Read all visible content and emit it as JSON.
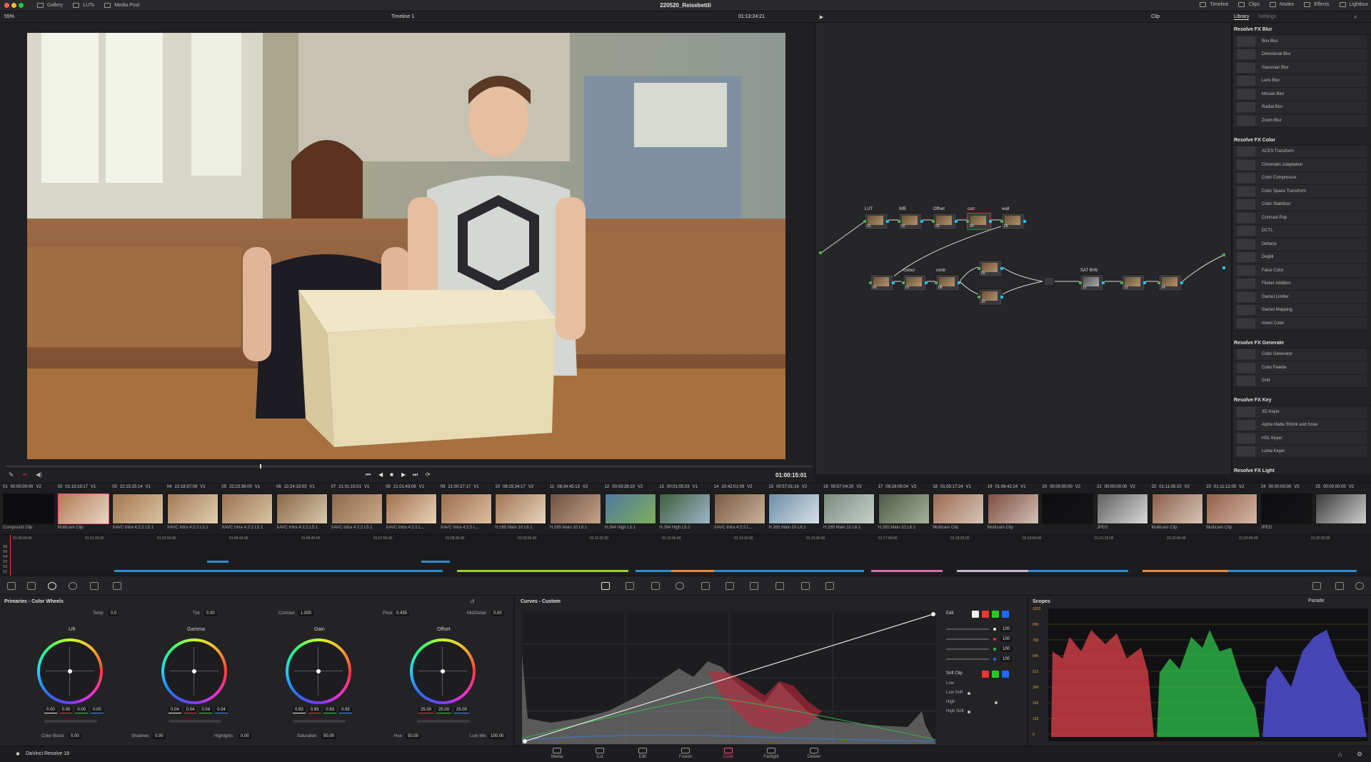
{
  "app": {
    "name": "DaVinci Resolve 18",
    "project_title": "220520_Reisebettli"
  },
  "topbar": {
    "left_buttons": [
      "Gallery",
      "LUTs",
      "Media Pool"
    ],
    "right_buttons": [
      "Timeline",
      "Clips",
      "Nodes",
      "Effects",
      "Lightbox"
    ]
  },
  "viewer": {
    "zoom": "55%",
    "timeline_name": "Timeline 1",
    "timecode": "01:13:24:21",
    "current_timecode": "01:00:15:01"
  },
  "node_editor": {
    "mode": "Clip",
    "nodes_row1": [
      {
        "label": "LUT",
        "num": "01"
      },
      {
        "label": "WB",
        "num": "02"
      },
      {
        "label": "Offset",
        "num": "03"
      },
      {
        "label": "corr",
        "num": "04"
      },
      {
        "label": "wall",
        "num": "05"
      }
    ],
    "nodes_row2": [
      {
        "label": "",
        "num": "06"
      },
      {
        "label": "colour",
        "num": "07"
      },
      {
        "label": "contr",
        "num": "08"
      },
      {
        "label": "",
        "num": "09"
      },
      {
        "label": "",
        "num": "10"
      },
      {
        "label": "SAT B/W",
        "num": "12"
      },
      {
        "label": "",
        "num": "13"
      },
      {
        "label": "",
        "num": "14"
      }
    ]
  },
  "library": {
    "tabs": [
      "Library",
      "Settings"
    ],
    "sections": [
      {
        "title": "Resolve FX Blur",
        "items": [
          "Box Blur",
          "Directional Blur",
          "Gaussian Blur",
          "Lens Blur",
          "Mosaic Blur",
          "Radial Blur",
          "Zoom Blur"
        ]
      },
      {
        "title": "Resolve FX Color",
        "items": [
          "ACES Transform",
          "Chromatic Adaptation",
          "Color Compressor",
          "Color Space Transform",
          "Color Stabilizer",
          "Contrast Pop",
          "DCTL",
          "Dehaze",
          "Deglill",
          "False Color",
          "Flicker Addition",
          "Gamut Limiter",
          "Gamut Mapping",
          "Invert Color"
        ]
      },
      {
        "title": "Resolve FX Generate",
        "items": [
          "Color Generator",
          "Color Palette",
          "Grid"
        ]
      },
      {
        "title": "Resolve FX Key",
        "items": [
          "3D Keyer",
          "Alpha Matte Shrink and Grow",
          "HSL Keyer",
          "Luma Keyer"
        ]
      },
      {
        "title": "Resolve FX Light",
        "items": []
      }
    ]
  },
  "clips": [
    {
      "num": "01",
      "tc": "00:00:00:00",
      "track": "V2",
      "codec": "Compound Clip"
    },
    {
      "num": "02",
      "tc": "01:13:19:17",
      "track": "V1",
      "codec": "Multicam Clip"
    },
    {
      "num": "03",
      "tc": "22:15:25:14",
      "track": "V1",
      "codec": "XAVC Intra 4:2:2 L5.1"
    },
    {
      "num": "04",
      "tc": "22:18:37:09",
      "track": "V1",
      "codec": "XAVC Intra 4:2:2 L5.1"
    },
    {
      "num": "05",
      "tc": "22:23:36:00",
      "track": "V1",
      "codec": "XAVC Intra 4:2:2 L5.1"
    },
    {
      "num": "06",
      "tc": "22:24:10:03",
      "track": "V1",
      "codec": "XAVC Intra 4:2:2 L5.1"
    },
    {
      "num": "07",
      "tc": "21:01:15:01",
      "track": "V1",
      "codec": "XAVC Intra 4:2:2 L5.1"
    },
    {
      "num": "08",
      "tc": "21:01:43:09",
      "track": "V1",
      "codec": "XAVC Intra 4:2:2 L..."
    },
    {
      "num": "09",
      "tc": "21:00:27:17",
      "track": "V1",
      "codec": "XAVC Intra 4:2:2 L..."
    },
    {
      "num": "10",
      "tc": "08:15:34:17",
      "track": "V2",
      "codec": "H.265 Main 10 L6.1"
    },
    {
      "num": "11",
      "tc": "08:34:45:13",
      "track": "V2",
      "codec": "H.265 Main 10 L6.1"
    },
    {
      "num": "12",
      "tc": "00:03:28:19",
      "track": "V2",
      "codec": "H.264 High L5.1"
    },
    {
      "num": "13",
      "tc": "00:01:05:03",
      "track": "V1",
      "codec": "H.264 High L5.1"
    },
    {
      "num": "14",
      "tc": "20:42:01:09",
      "track": "V2",
      "codec": "XAVC Intra 4:2:2 L..."
    },
    {
      "num": "15",
      "tc": "00:57:01:16",
      "track": "V2",
      "codec": "H.265 Main 10 L6.1"
    },
    {
      "num": "16",
      "tc": "00:57:04:20",
      "track": "V2",
      "codec": "H.265 Main 10 L6.1"
    },
    {
      "num": "17",
      "tc": "09:26:05:04",
      "track": "V2",
      "codec": "H.265 Main 10 L6.1"
    },
    {
      "num": "18",
      "tc": "01:05:17:24",
      "track": "V1",
      "codec": "Multicam Clip"
    },
    {
      "num": "19",
      "tc": "01:06:42:24",
      "track": "V1",
      "codec": "Multicam Clip"
    },
    {
      "num": "20",
      "tc": "00:00:00:00",
      "track": "V2",
      "codec": ""
    },
    {
      "num": "21",
      "tc": "00:00:00:00",
      "track": "V2",
      "codec": "JPEG"
    },
    {
      "num": "22",
      "tc": "01:11:05:10",
      "track": "V2",
      "codec": "Multicam Clip"
    },
    {
      "num": "23",
      "tc": "01:11:12:00",
      "track": "V2",
      "codec": "Multicam Clip"
    },
    {
      "num": "24",
      "tc": "00:00:00:00",
      "track": "V2",
      "codec": "JPEG"
    },
    {
      "num": "25",
      "tc": "00:00:00:00",
      "track": "V2",
      "codec": ""
    }
  ],
  "mini_timeline": {
    "ruler": [
      "01:00:00:00",
      "01:01:25:00",
      "01:02:50:00",
      "01:04:15:00",
      "01:05:40:00",
      "01:07:05:00",
      "01:08:30:00",
      "01:09:55:00",
      "01:11:20:00",
      "01:12:45:00",
      "01:14:10:00",
      "01:15:35:00",
      "01:17:00:00",
      "01:18:25:00",
      "01:19:50:00",
      "01:21:15:00",
      "01:22:40:00",
      "01:24:05:00",
      "01:25:30:00"
    ],
    "tracks": [
      "V6",
      "V5",
      "V4",
      "V3",
      "V2",
      "V1"
    ]
  },
  "primaries": {
    "title": "Primaries - Color Wheels",
    "temp_label": "Temp",
    "temp": "0.0",
    "tint_label": "Tint",
    "tint": "0.00",
    "contrast_label": "Contrast",
    "contrast": "1.000",
    "pivot_label": "Pivot",
    "pivot": "0.435",
    "middetail_label": "Mid/Detail",
    "middetail": "0.00",
    "wheels": [
      {
        "name": "Lift",
        "values": [
          "0.00",
          "0.00",
          "0.00",
          "0.00"
        ]
      },
      {
        "name": "Gamma",
        "values": [
          "0.04",
          "0.04",
          "0.04",
          "0.04"
        ]
      },
      {
        "name": "Gain",
        "values": [
          "0.93",
          "0.93",
          "0.93",
          "0.93"
        ]
      },
      {
        "name": "Offset",
        "values": [
          "25.00",
          "25.00",
          "25.00"
        ]
      }
    ],
    "colorboost_label": "Color Boost",
    "colorboost": "0.00",
    "shadows_label": "Shadows",
    "shadows": "0.00",
    "highlights_label": "Highlights",
    "highlights": "0.00",
    "saturation_label": "Saturation",
    "saturation": "50.00",
    "hue_label": "Hue",
    "hue": "50.00",
    "lummix_label": "Lum Mix",
    "lummix": "100.00"
  },
  "curves": {
    "title": "Curves - Custom",
    "edit_label": "Edit",
    "channel_values": [
      "100",
      "100",
      "100",
      "100"
    ],
    "softclip_label": "Soft Clip",
    "low_label": "Low",
    "lowsoft_label": "Low Soft",
    "high_label": "High",
    "highsoft_label": "High Soft"
  },
  "scopes": {
    "title": "Scopes",
    "mode": "Parade",
    "scale": [
      "1023",
      "896",
      "768",
      "640",
      "512",
      "384",
      "256",
      "128",
      "0"
    ]
  },
  "pages": [
    "Media",
    "Cut",
    "Edit",
    "Fusion",
    "Color",
    "Fairlight",
    "Deliver"
  ],
  "active_page": "Color",
  "colors": {
    "accent": "#ff4f7a",
    "node_green": "#4caf50",
    "node_blue": "#22c4ff"
  }
}
